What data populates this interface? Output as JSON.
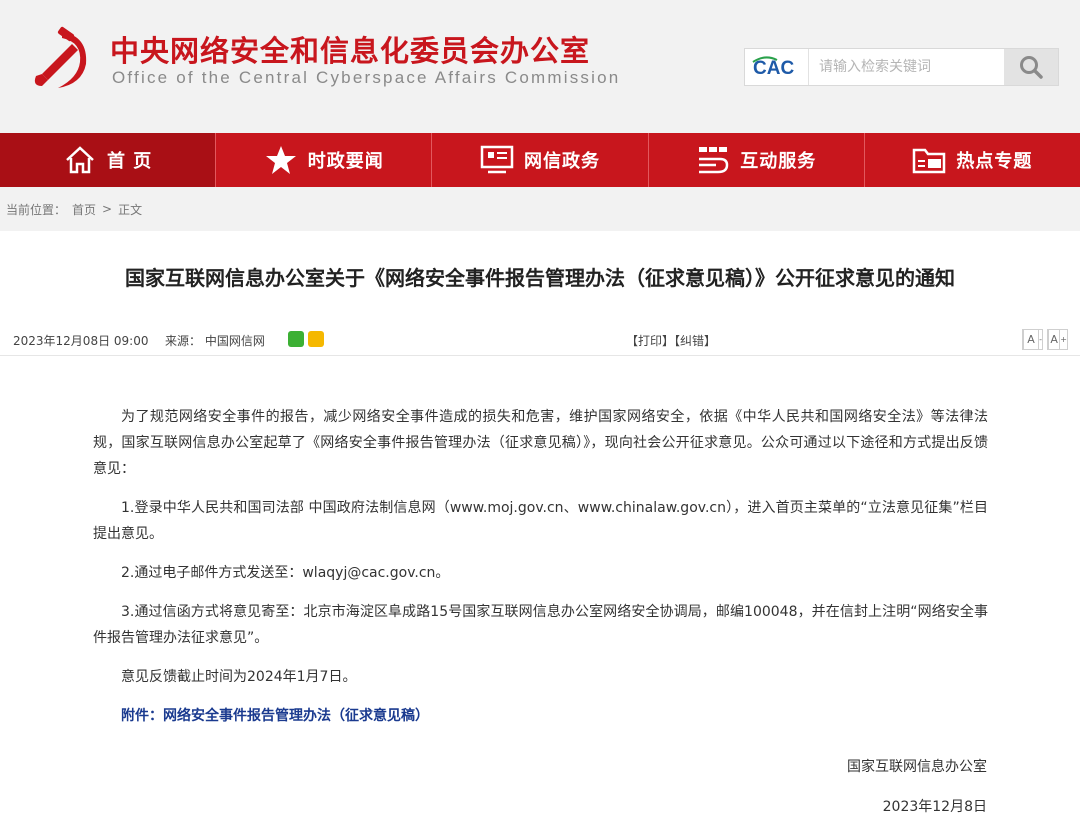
{
  "header": {
    "title_cn": "中央网络安全和信息化委员会办公室",
    "title_en": "Office of the Central Cyberspace Affairs Commission",
    "search": {
      "logo_text": "CAC",
      "placeholder": "请输入检索关键词"
    }
  },
  "nav": [
    {
      "label": "首 页",
      "icon": "home-icon"
    },
    {
      "label": "时政要闻",
      "icon": "star-icon"
    },
    {
      "label": "网信政务",
      "icon": "monitor-icon"
    },
    {
      "label": "互动服务",
      "icon": "handshake-icon"
    },
    {
      "label": "热点专题",
      "icon": "folder-icon"
    }
  ],
  "breadcrumb": {
    "prefix": "当前位置：",
    "home": "首页",
    "sep": ">",
    "current": "正文"
  },
  "article": {
    "title": "国家互联网信息办公室关于《网络安全事件报告管理办法（征求意见稿）》公开征求意见的通知",
    "date": "2023年12月08日 09:00",
    "source_label": "来源：",
    "source": "中国网信网",
    "print_tools": "【打印】【纠错】",
    "font_small": "A",
    "font_large": "A",
    "paragraphs": [
      "为了规范网络安全事件的报告，减少网络安全事件造成的损失和危害，维护国家网络安全，依据《中华人民共和国网络安全法》等法律法规，国家互联网信息办公室起草了《网络安全事件报告管理办法（征求意见稿）》，现向社会公开征求意见。公众可通过以下途径和方式提出反馈意见：",
      "1.登录中华人民共和国司法部 中国政府法制信息网（www.moj.gov.cn、www.chinalaw.gov.cn），进入首页主菜单的“立法意见征集”栏目提出意见。",
      "2.通过电子邮件方式发送至：wlaqyj@cac.gov.cn。",
      "3.通过信函方式将意见寄至：北京市海淀区阜成路15号国家互联网信息办公室网络安全协调局，邮编100048，并在信封上注明“网络安全事件报告管理办法征求意见”。",
      "意见反馈截止时间为2024年1月7日。"
    ],
    "attachment": "附件：网络安全事件报告管理办法（征求意见稿）",
    "signature": "国家互联网信息办公室",
    "sign_date": "2023年12月8日"
  },
  "colors": {
    "brand_red": "#c8161d",
    "attachment_blue": "#1a3a8f"
  }
}
